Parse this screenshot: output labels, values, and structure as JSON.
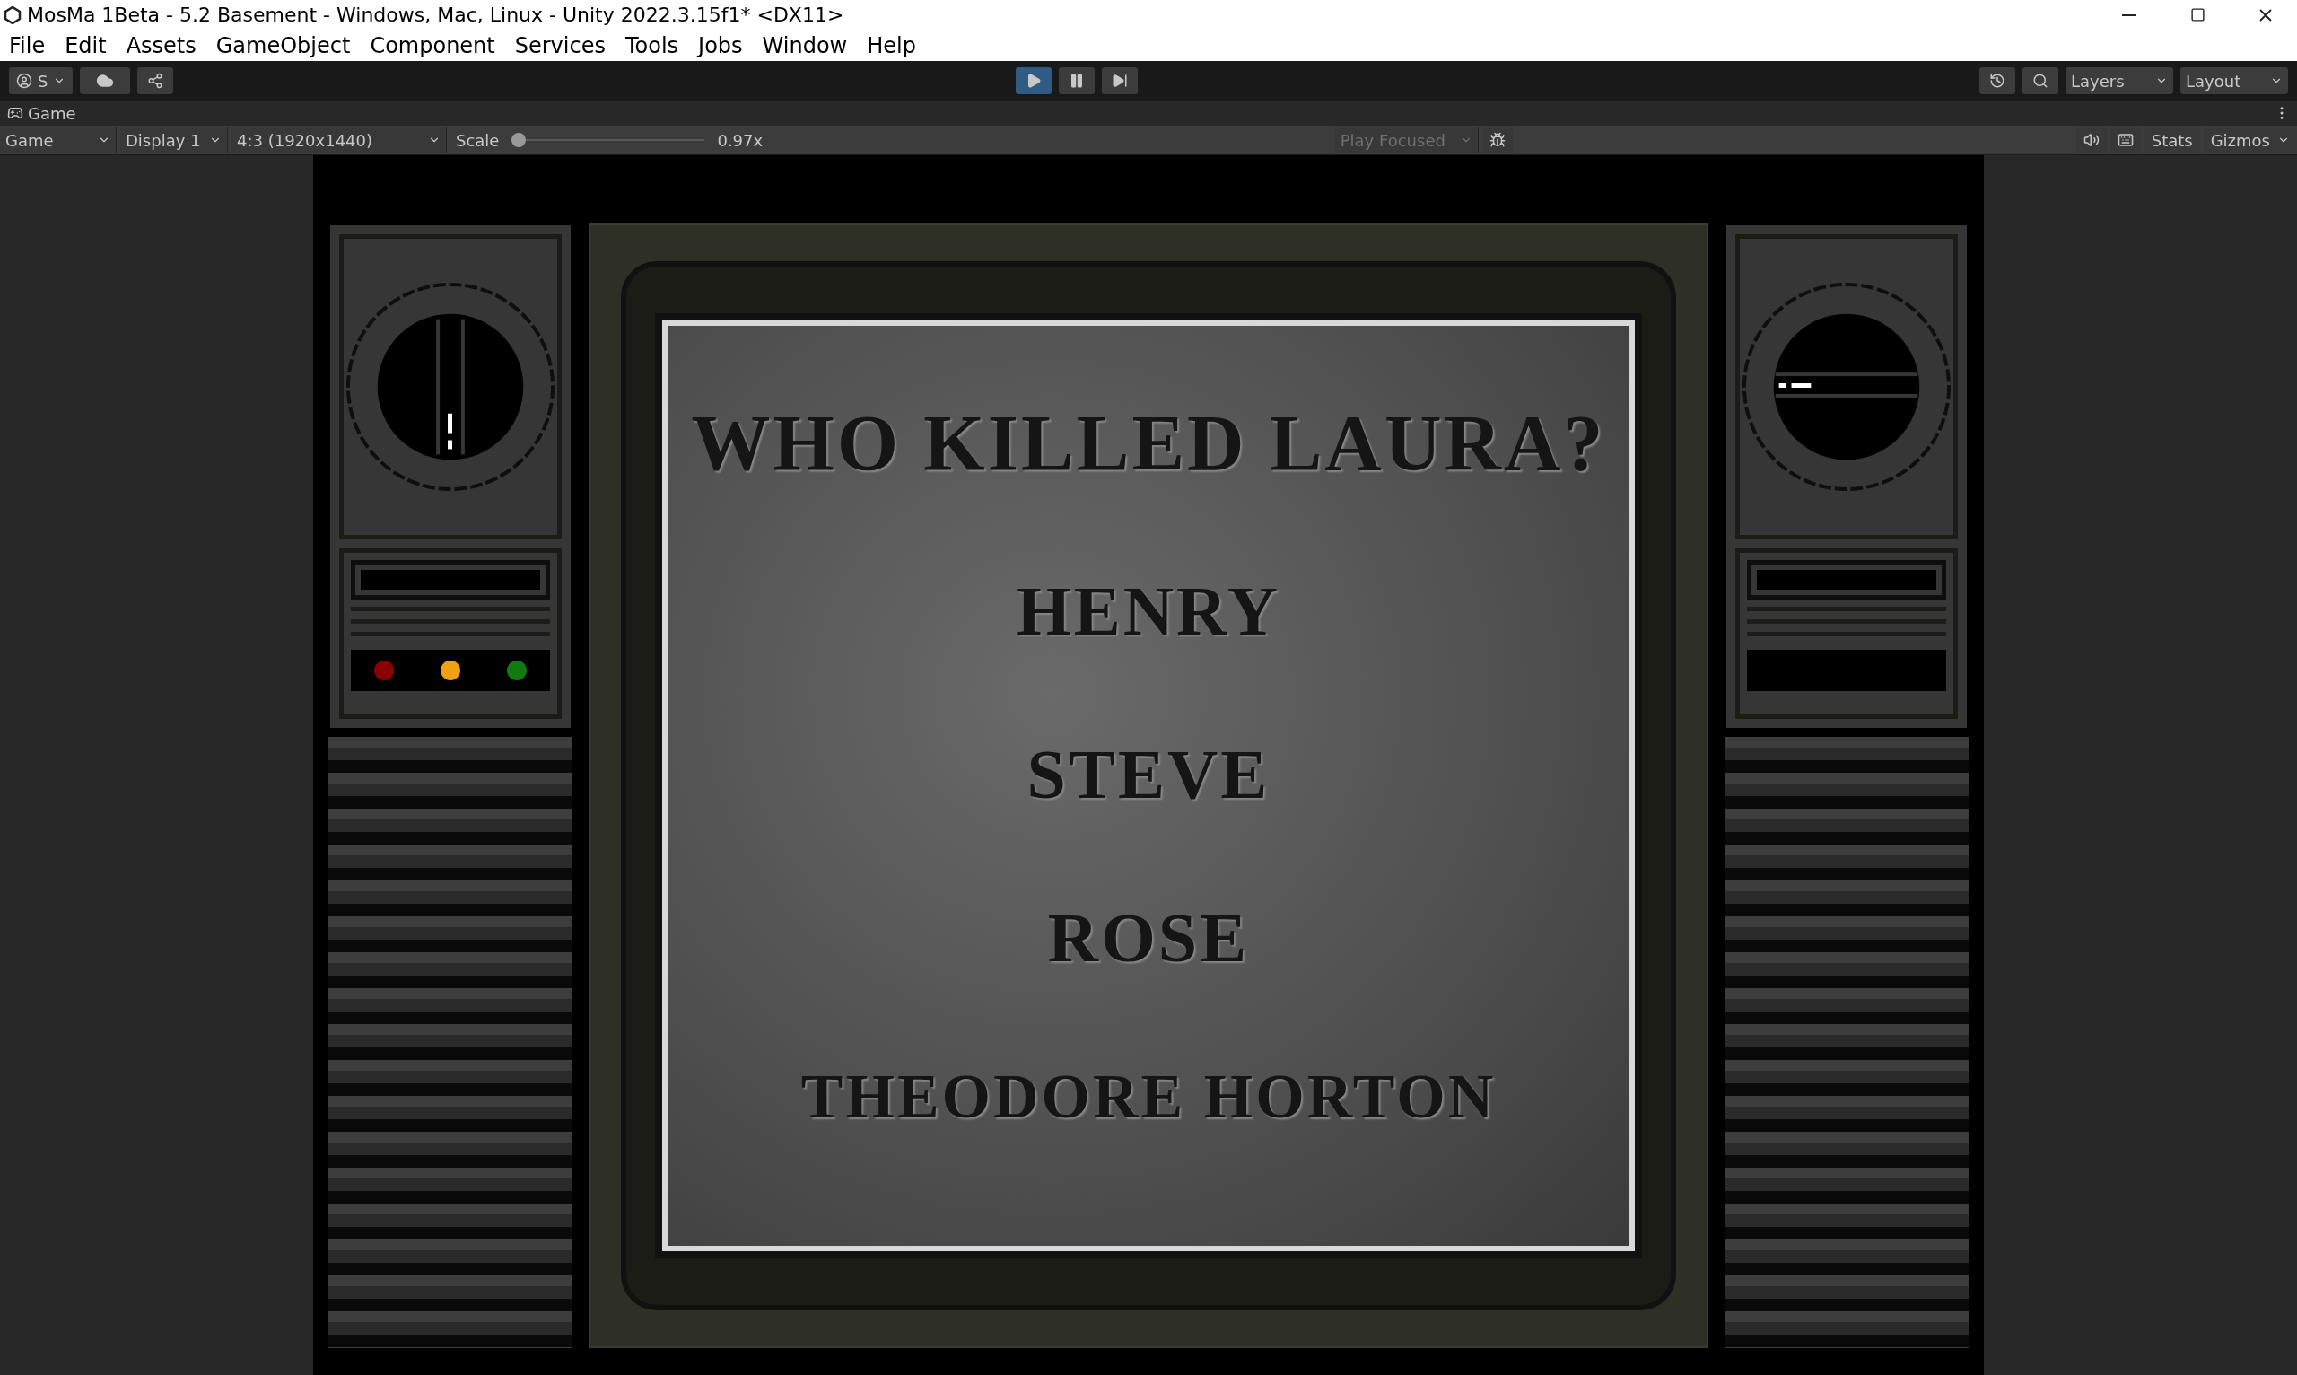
{
  "window": {
    "title": "MosMa 1Beta - 5.2 Basement - Windows, Mac, Linux - Unity 2022.3.15f1* <DX11>"
  },
  "menu": [
    "File",
    "Edit",
    "Assets",
    "GameObject",
    "Component",
    "Services",
    "Tools",
    "Jobs",
    "Window",
    "Help"
  ],
  "toolbar": {
    "account": "S",
    "playing": true,
    "paused": false,
    "layers": "Layers",
    "layout": "Layout"
  },
  "game_tab": {
    "label": "Game"
  },
  "game_toolbar": {
    "view": "Game",
    "display": "Display 1",
    "aspect": "4:3 (1920x1440)",
    "scale_label": "Scale",
    "scale": {
      "level": 0.0
    },
    "scale_reading": "0.97x",
    "play_mode": "Play Focused",
    "stats": "Stats",
    "gizmos": "Gizmos"
  },
  "game": {
    "question": "WHO KILLED LAURA?",
    "options": [
      "HENRY",
      "STEVE",
      "ROSE",
      "THEODORE HORTON"
    ],
    "left_lights": [
      {
        "color": "#8a0000"
      },
      {
        "color": "#f0a010"
      },
      {
        "color": "#117a11"
      }
    ]
  }
}
